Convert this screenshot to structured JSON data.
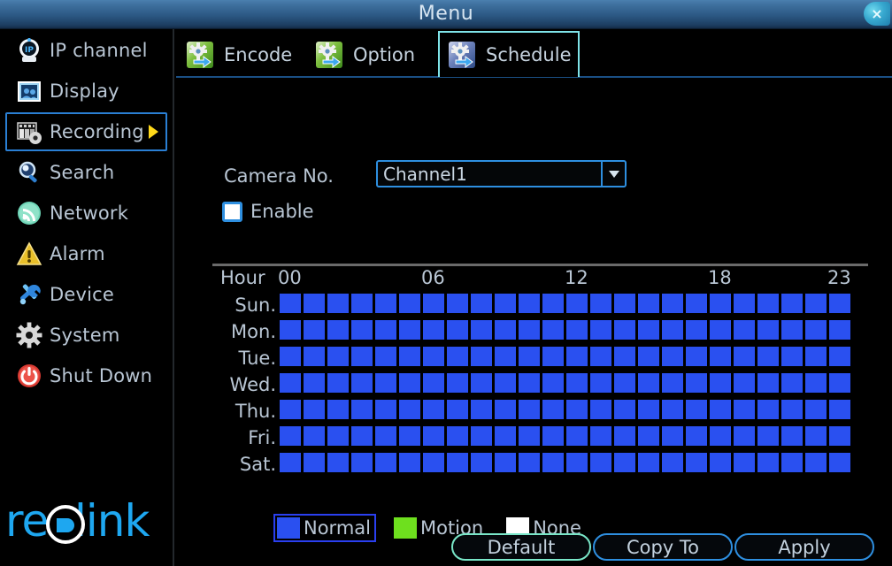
{
  "window": {
    "title": "Menu",
    "close_label": "×",
    "accent_blue": "#2e8fe0",
    "accent_cyan": "#7fe3e8",
    "text_color": "#b9c6d4"
  },
  "sidebar": {
    "items": [
      {
        "label": "IP channel",
        "icon": "ip-camera-icon",
        "active": false,
        "arrow": false
      },
      {
        "label": "Display",
        "icon": "display-icon",
        "active": false,
        "arrow": false
      },
      {
        "label": "Recording",
        "icon": "recording-icon",
        "active": true,
        "arrow": true
      },
      {
        "label": "Search",
        "icon": "magnifier-icon",
        "active": false,
        "arrow": false
      },
      {
        "label": "Network",
        "icon": "network-signal-icon",
        "active": false,
        "arrow": false
      },
      {
        "label": "Alarm",
        "icon": "warning-triangle-icon",
        "active": false,
        "arrow": false
      },
      {
        "label": "Device",
        "icon": "tools-icon",
        "active": false,
        "arrow": false
      },
      {
        "label": "System",
        "icon": "gear-icon",
        "active": false,
        "arrow": false
      },
      {
        "label": "Shut Down",
        "icon": "power-icon",
        "active": false,
        "arrow": false
      }
    ],
    "brand": "reolink",
    "brand_color": "#1ea7f0"
  },
  "tabs": [
    {
      "label": "Encode",
      "active": false
    },
    {
      "label": "Option",
      "active": false
    },
    {
      "label": "Schedule",
      "active": true
    }
  ],
  "form": {
    "camera_label": "Camera No.",
    "camera_value": "Channel1",
    "camera_options": [
      "Channel1"
    ],
    "enable_label": "Enable",
    "enable_checked": false
  },
  "schedule": {
    "hour_label": "Hour",
    "hour_ticks": [
      {
        "text": "00",
        "hour": 0
      },
      {
        "text": "06",
        "hour": 6
      },
      {
        "text": "12",
        "hour": 12
      },
      {
        "text": "18",
        "hour": 18
      },
      {
        "text": "23",
        "hour": 23
      }
    ],
    "days": [
      "Sun.",
      "Mon.",
      "Tue.",
      "Wed.",
      "Thu.",
      "Fri.",
      "Sat."
    ],
    "hours_per_day": 24,
    "cells": [
      [
        "normal",
        "normal",
        "normal",
        "normal",
        "normal",
        "normal",
        "normal",
        "normal",
        "normal",
        "normal",
        "normal",
        "normal",
        "normal",
        "normal",
        "normal",
        "normal",
        "normal",
        "normal",
        "normal",
        "normal",
        "normal",
        "normal",
        "normal",
        "normal"
      ],
      [
        "normal",
        "normal",
        "normal",
        "normal",
        "normal",
        "normal",
        "normal",
        "normal",
        "normal",
        "normal",
        "normal",
        "normal",
        "normal",
        "normal",
        "normal",
        "normal",
        "normal",
        "normal",
        "normal",
        "normal",
        "normal",
        "normal",
        "normal",
        "normal"
      ],
      [
        "normal",
        "normal",
        "normal",
        "normal",
        "normal",
        "normal",
        "normal",
        "normal",
        "normal",
        "normal",
        "normal",
        "normal",
        "normal",
        "normal",
        "normal",
        "normal",
        "normal",
        "normal",
        "normal",
        "normal",
        "normal",
        "normal",
        "normal",
        "normal"
      ],
      [
        "normal",
        "normal",
        "normal",
        "normal",
        "normal",
        "normal",
        "normal",
        "normal",
        "normal",
        "normal",
        "normal",
        "normal",
        "normal",
        "normal",
        "normal",
        "normal",
        "normal",
        "normal",
        "normal",
        "normal",
        "normal",
        "normal",
        "normal",
        "normal"
      ],
      [
        "normal",
        "normal",
        "normal",
        "normal",
        "normal",
        "normal",
        "normal",
        "normal",
        "normal",
        "normal",
        "normal",
        "normal",
        "normal",
        "normal",
        "normal",
        "normal",
        "normal",
        "normal",
        "normal",
        "normal",
        "normal",
        "normal",
        "normal",
        "normal"
      ],
      [
        "normal",
        "normal",
        "normal",
        "normal",
        "normal",
        "normal",
        "normal",
        "normal",
        "normal",
        "normal",
        "normal",
        "normal",
        "normal",
        "normal",
        "normal",
        "normal",
        "normal",
        "normal",
        "normal",
        "normal",
        "normal",
        "normal",
        "normal",
        "normal"
      ],
      [
        "normal",
        "normal",
        "normal",
        "normal",
        "normal",
        "normal",
        "normal",
        "normal",
        "normal",
        "normal",
        "normal",
        "normal",
        "normal",
        "normal",
        "normal",
        "normal",
        "normal",
        "normal",
        "normal",
        "normal",
        "normal",
        "normal",
        "normal",
        "normal"
      ]
    ]
  },
  "legend": [
    {
      "label": "Normal",
      "color": "#2a50f0",
      "selected": true
    },
    {
      "label": "Motion",
      "color": "#6ee01e",
      "selected": false
    },
    {
      "label": "None",
      "color": "#ffffff",
      "selected": false
    }
  ],
  "buttons": [
    {
      "label": "Default",
      "style": "focus"
    },
    {
      "label": "Copy To",
      "style": "plain"
    },
    {
      "label": "Apply",
      "style": "plain"
    }
  ]
}
